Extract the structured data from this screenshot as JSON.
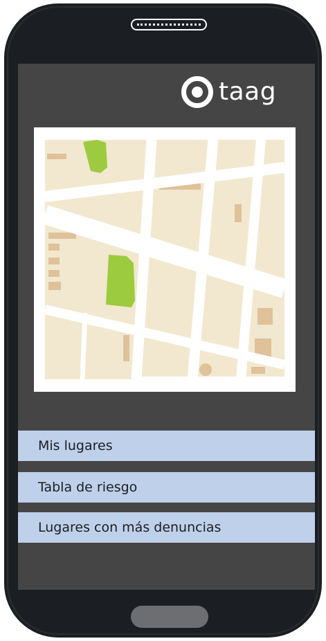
{
  "app": {
    "name": "taag",
    "logo_icon": "ring-dot-logo-icon"
  },
  "map": {
    "icon": "map-illustration",
    "colors": {
      "land": "#f1e8cf",
      "road": "#ffffff",
      "park": "#9ccb3f",
      "building": "#dfc19a"
    }
  },
  "menu": {
    "items": [
      {
        "label": "Mis lugares"
      },
      {
        "label": "Tabla de riesgo"
      },
      {
        "label": "Lugares con más denuncias"
      }
    ]
  },
  "device": {
    "body_color": "#1b1e22",
    "screen_color": "#454545",
    "menu_color": "#bfd0ea"
  }
}
